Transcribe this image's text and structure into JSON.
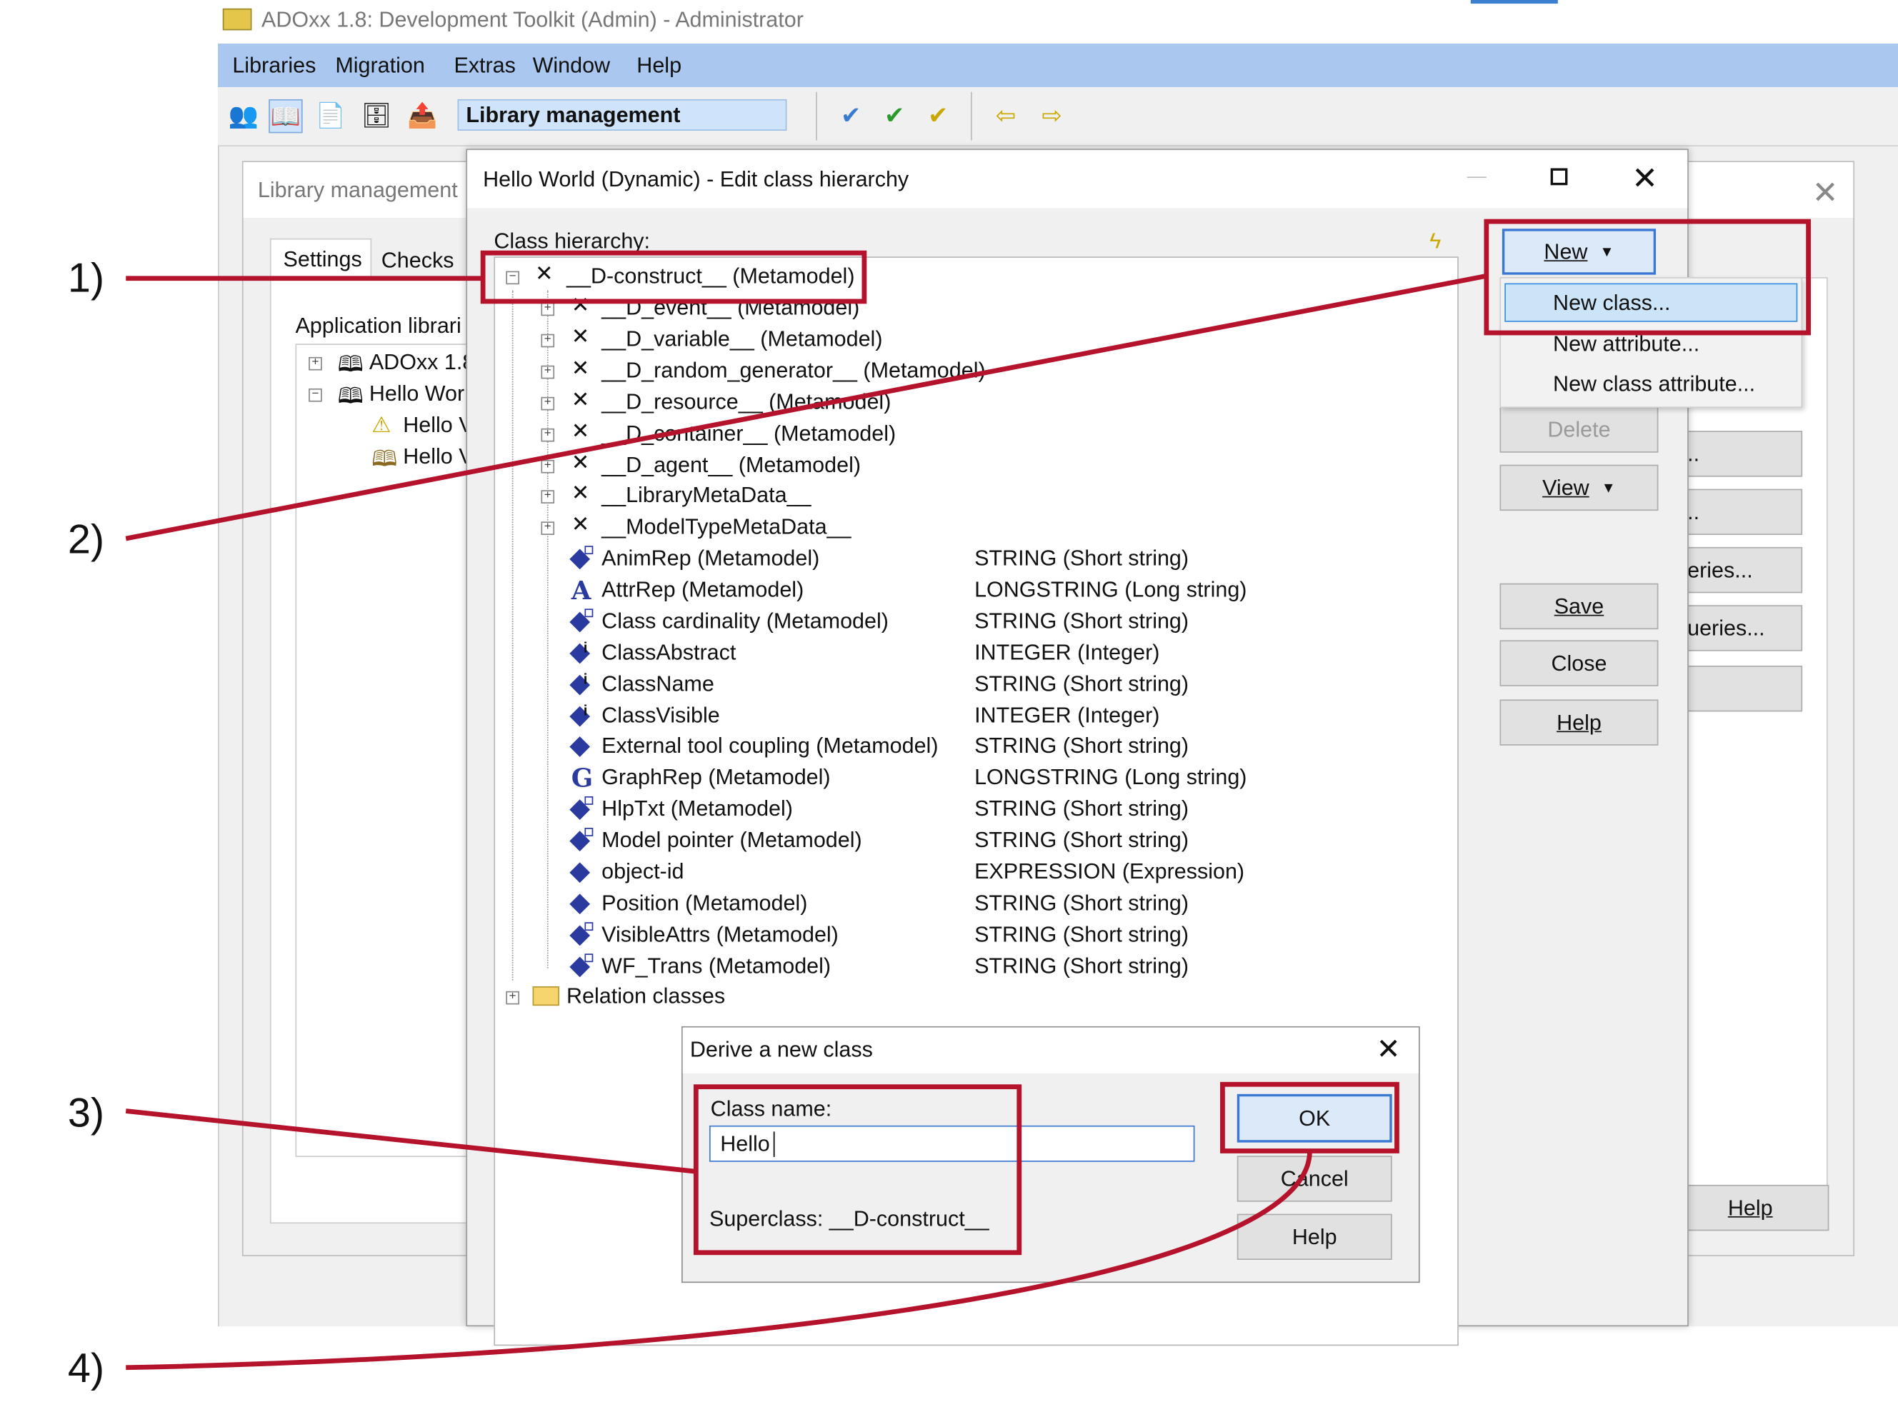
{
  "app": {
    "title": "ADOxx 1.8: Development Toolkit (Admin) - Administrator",
    "menu": [
      "Libraries",
      "Migration",
      "Extras",
      "Window",
      "Help"
    ],
    "toolbar_mode": "Library management"
  },
  "library_window": {
    "title": "Library management",
    "tabs": [
      "Settings",
      "Checks"
    ],
    "section_label": "Application librari",
    "tree": [
      "ADOxx 1.8",
      "Hello Wor",
      "Hello V",
      "Hello V"
    ],
    "right_buttons": [
      "..",
      "..",
      "eries...",
      "ueries...",
      ""
    ],
    "help": "Help"
  },
  "dialog": {
    "title": "Hello World (Dynamic) - Edit class hierarchy",
    "label": "Class hierarchy:",
    "root": "__D-construct__ (Metamodel)",
    "classes": [
      "__D_event__ (Metamodel)",
      "__D_variable__ (Metamodel)",
      "__D_random_generator__ (Metamodel)",
      "__D_resource__ (Metamodel)",
      "__D_container__ (Metamodel)",
      "__D_agent__ (Metamodel)",
      "__LibraryMetaData__",
      "__ModelTypeMetaData__"
    ],
    "attributes": [
      {
        "name": "AnimRep (Metamodel)",
        "type": "STRING (Short string)",
        "icon": "diamond-class-attr"
      },
      {
        "name": "AttrRep (Metamodel)",
        "type": "LONGSTRING (Long string)",
        "icon": "A"
      },
      {
        "name": "Class cardinality (Metamodel)",
        "type": "STRING (Short string)",
        "icon": "diamond-class-attr"
      },
      {
        "name": "ClassAbstract",
        "type": "INTEGER (Integer)",
        "icon": "diamond-info"
      },
      {
        "name": "ClassName",
        "type": "STRING (Short string)",
        "icon": "diamond-info"
      },
      {
        "name": "ClassVisible",
        "type": "INTEGER (Integer)",
        "icon": "diamond-info"
      },
      {
        "name": "External tool coupling (Metamodel)",
        "type": "STRING (Short string)",
        "icon": "diamond"
      },
      {
        "name": "GraphRep (Metamodel)",
        "type": "LONGSTRING (Long string)",
        "icon": "G"
      },
      {
        "name": "HlpTxt (Metamodel)",
        "type": "STRING (Short string)",
        "icon": "diamond-class-attr"
      },
      {
        "name": "Model pointer (Metamodel)",
        "type": "STRING (Short string)",
        "icon": "diamond-class-attr"
      },
      {
        "name": "object-id",
        "type": "EXPRESSION (Expression)",
        "icon": "diamond"
      },
      {
        "name": "Position (Metamodel)",
        "type": "STRING (Short string)",
        "icon": "diamond"
      },
      {
        "name": "VisibleAttrs (Metamodel)",
        "type": "STRING (Short string)",
        "icon": "diamond-class-attr"
      },
      {
        "name": "WF_Trans (Metamodel)",
        "type": "STRING (Short string)",
        "icon": "diamond-class-attr"
      }
    ],
    "relation_classes": "Relation classes",
    "buttons": {
      "new": "New",
      "delete": "Delete",
      "view": "View",
      "save": "Save",
      "close": "Close",
      "help": "Help"
    },
    "new_menu": [
      "New class...",
      "New attribute...",
      "New class attribute..."
    ]
  },
  "derive_dialog": {
    "title": "Derive a new class",
    "class_name_label": "Class name:",
    "class_name_value": "Hello",
    "superclass": "Superclass: __D-construct__",
    "ok": "OK",
    "cancel": "Cancel",
    "help": "Help"
  },
  "steps": [
    "1)",
    "2)",
    "3)",
    "4)"
  ],
  "colors": {
    "annotation": "#b5122c",
    "menubar": "#a9c7ef",
    "selection": "#cce4f7"
  }
}
